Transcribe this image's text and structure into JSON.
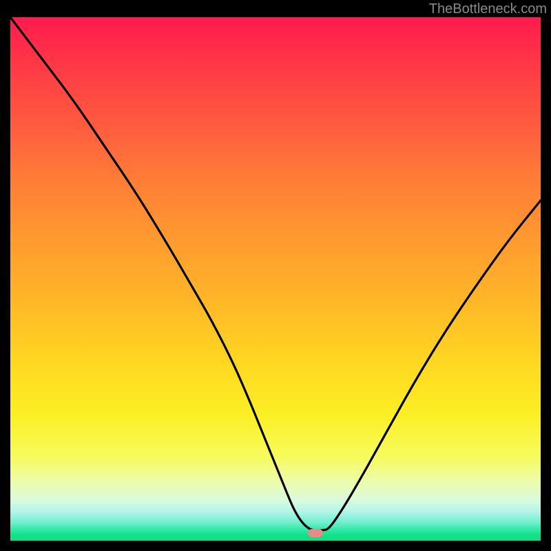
{
  "watermark": "TheBottleneck.com",
  "chart_data": {
    "type": "line",
    "title": "",
    "xlabel": "",
    "ylabel": "",
    "xlim": [
      0,
      100
    ],
    "ylim": [
      0,
      100
    ],
    "grid": false,
    "series": [
      {
        "name": "curve",
        "x": [
          0,
          6,
          12,
          18,
          24,
          30,
          34,
          38,
          42,
          45,
          47,
          49,
          51,
          53,
          54,
          55,
          56,
          57,
          58,
          59,
          60,
          62,
          65,
          70,
          76,
          82,
          88,
          94,
          100
        ],
        "y": [
          100,
          92,
          84,
          75,
          66,
          56,
          49,
          42,
          34,
          27,
          22,
          17,
          12,
          7,
          5,
          3.5,
          2.5,
          2,
          2,
          2,
          2.2,
          5,
          10,
          19,
          30,
          40,
          49,
          57.5,
          65
        ]
      }
    ],
    "marker": {
      "x": 57.5,
      "y": 1.5,
      "color": "#e88a87"
    },
    "gradient_note": "vertical gradient red→orange→yellow→green",
    "legend": false
  }
}
